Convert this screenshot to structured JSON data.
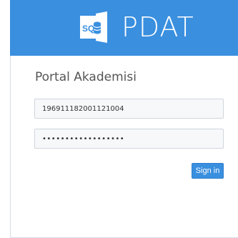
{
  "header": {
    "logo_text": "SQL",
    "title": "PDAT"
  },
  "login": {
    "title": "Portal Akademisi",
    "username_value": "196911182001121004",
    "password_value": "••••••••••••••••••",
    "submit_label": "Sign in"
  },
  "colors": {
    "accent": "#3a8fdf",
    "panel_bg": "#ffffff"
  }
}
